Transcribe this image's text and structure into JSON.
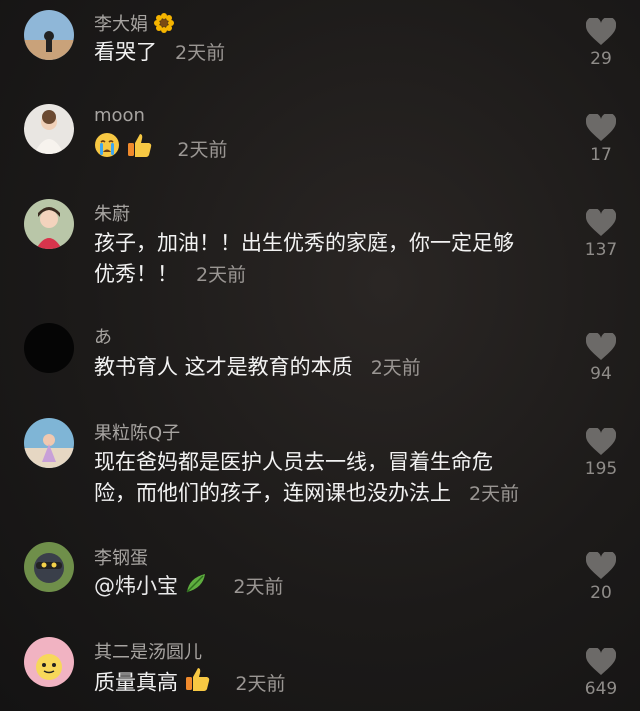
{
  "comments": [
    {
      "user": "李大娟",
      "text": "看哭了",
      "time": "2天前",
      "likes": "29"
    },
    {
      "user": "moon",
      "text": "",
      "time": "2天前",
      "likes": "17"
    },
    {
      "user": "朱蔚",
      "text_line1": "孩子，加油！！出生优秀的家庭，你一定足够",
      "text_line2": "优秀！！",
      "time": "2天前",
      "likes": "137"
    },
    {
      "user": "あ",
      "text": "教书育人 这才是教育的本质",
      "time": "2天前",
      "likes": "94"
    },
    {
      "user": "果粒陈Q子",
      "text_line1": "现在爸妈都是医护人员去一线，冒着生命危",
      "text_line2": "险，而他们的孩子，连网课也没办法上",
      "time": "2天前",
      "likes": "195"
    },
    {
      "user": "李钢蛋",
      "text": "@炜小宝",
      "time": "2天前",
      "likes": "20"
    },
    {
      "user": "其二是汤圆儿",
      "text": "质量真高",
      "time": "2天前",
      "likes": "649"
    }
  ],
  "icons": {
    "like": "heart-icon",
    "sunflower": "sunflower-icon",
    "crying": "crying-face-icon",
    "thumbs": "thumbs-up-icon",
    "leaf": "leaf-icon"
  }
}
